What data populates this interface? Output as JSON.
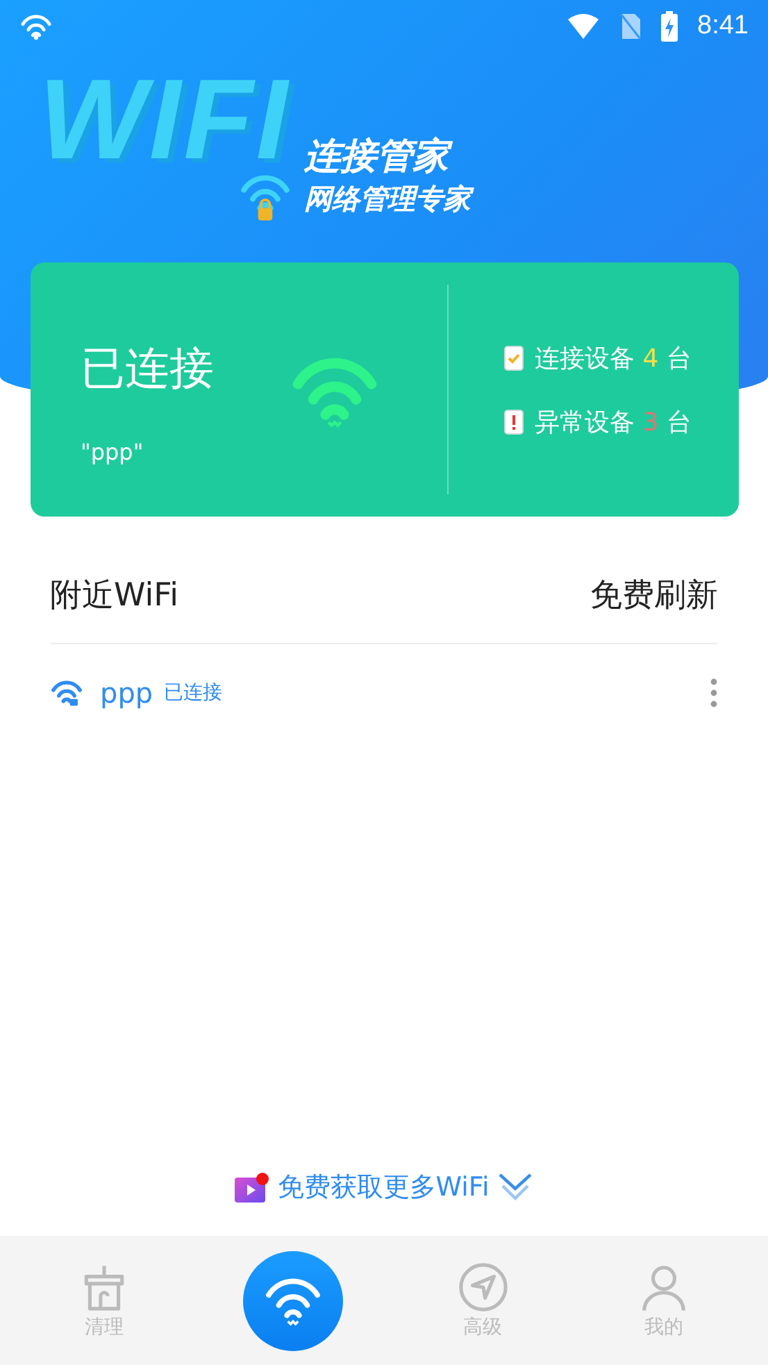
{
  "status_bar": {
    "time": "8:41"
  },
  "header": {
    "logo_text": "WIFI",
    "title": "连接管家",
    "subtitle": "网络管理专家"
  },
  "status_card": {
    "state": "已连接",
    "ssid": "\"ppp\"",
    "stats": [
      {
        "kind": "ok",
        "label": "连接设备",
        "count": "4",
        "unit": "台",
        "color": "#f5e04a"
      },
      {
        "kind": "warning",
        "label": "异常设备",
        "count": "3",
        "unit": "台",
        "color": "#e57373"
      }
    ]
  },
  "nearby": {
    "title": "附近WiFi",
    "action": "免费刷新",
    "networks": [
      {
        "name": "ppp",
        "status": "已连接",
        "locked": true
      }
    ]
  },
  "promo": {
    "text": "免费获取更多WiFi",
    "badge": true
  },
  "tab_bar": [
    {
      "kind": "clean",
      "label": "清理",
      "selected": false
    },
    {
      "kind": "wifi",
      "selected": true
    },
    {
      "kind": "advanced",
      "label": "高级",
      "selected": false
    },
    {
      "kind": "profile",
      "label": "我的",
      "selected": false
    }
  ]
}
